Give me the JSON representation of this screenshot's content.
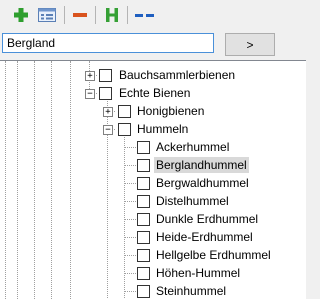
{
  "toolbar": {
    "icons": [
      "add-icon",
      "properties-icon",
      "remove-icon",
      "h-icon",
      "collapse-icon"
    ],
    "colors": {
      "add": "#2e9e2e",
      "remove": "#d9531e",
      "h": "#35a035",
      "collapse": "#1f5fc0"
    }
  },
  "search": {
    "value": "Bergland",
    "go_label": ">"
  },
  "tree": {
    "selected": "Berglandhummel",
    "items": [
      {
        "label": "Bauchsammlerbienen",
        "expander": "+"
      },
      {
        "label": "Echte Bienen",
        "expander": "−"
      },
      {
        "label": "Honigbienen",
        "expander": "+"
      },
      {
        "label": "Hummeln",
        "expander": "−"
      },
      {
        "label": "Ackerhummel"
      },
      {
        "label": "Berglandhummel"
      },
      {
        "label": "Bergwaldhummel"
      },
      {
        "label": "Distelhummel"
      },
      {
        "label": "Dunkle Erdhummel"
      },
      {
        "label": "Heide-Erdhummel"
      },
      {
        "label": "Hellgelbe Erdhummel"
      },
      {
        "label": "Höhen-Hummel"
      },
      {
        "label": "Steinhummel"
      }
    ]
  }
}
